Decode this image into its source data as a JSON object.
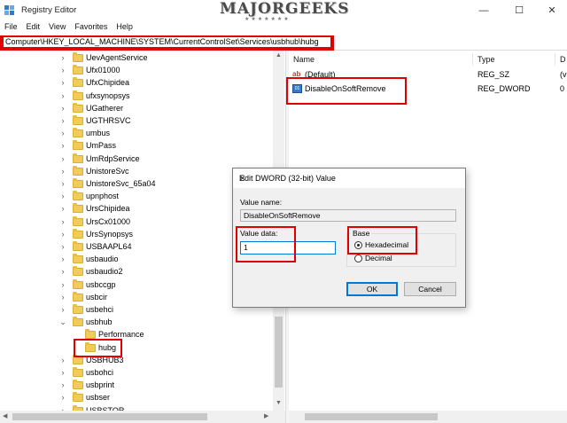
{
  "window": {
    "title": "Registry Editor",
    "watermark": "MAJORGEEKS",
    "watermark_sub": "★★★★★★★",
    "minimize": "—",
    "maximize": "☐",
    "close": "✕"
  },
  "menu": [
    "File",
    "Edit",
    "View",
    "Favorites",
    "Help"
  ],
  "address": "Computer\\HKEY_LOCAL_MACHINE\\SYSTEM\\CurrentControlSet\\Services\\usbhub\\hubg",
  "tree": [
    {
      "label": "UevAgentService",
      "chev": "›"
    },
    {
      "label": "Ufx01000",
      "chev": "›"
    },
    {
      "label": "UfxChipidea",
      "chev": "›"
    },
    {
      "label": "ufxsynopsys",
      "chev": "›"
    },
    {
      "label": "UGatherer",
      "chev": "›"
    },
    {
      "label": "UGTHRSVC",
      "chev": "›"
    },
    {
      "label": "umbus",
      "chev": "›"
    },
    {
      "label": "UmPass",
      "chev": "›"
    },
    {
      "label": "UmRdpService",
      "chev": "›"
    },
    {
      "label": "UnistoreSvc",
      "chev": "›"
    },
    {
      "label": "UnistoreSvc_65a04",
      "chev": "›"
    },
    {
      "label": "upnphost",
      "chev": "›"
    },
    {
      "label": "UrsChipidea",
      "chev": "›"
    },
    {
      "label": "UrsCx01000",
      "chev": "›"
    },
    {
      "label": "UrsSynopsys",
      "chev": "›"
    },
    {
      "label": "USBAAPL64",
      "chev": "›"
    },
    {
      "label": "usbaudio",
      "chev": "›"
    },
    {
      "label": "usbaudio2",
      "chev": "›"
    },
    {
      "label": "usbccgp",
      "chev": "›"
    },
    {
      "label": "usbcir",
      "chev": "›"
    },
    {
      "label": "usbehci",
      "chev": "›"
    },
    {
      "label": "usbhub",
      "chev": "⌄"
    },
    {
      "label": "Performance",
      "chev": ""
    },
    {
      "label": "hubg",
      "chev": ""
    },
    {
      "label": "USBHUB3",
      "chev": "›"
    },
    {
      "label": "usbohci",
      "chev": "›"
    },
    {
      "label": "usbprint",
      "chev": "›"
    },
    {
      "label": "usbser",
      "chev": "›"
    },
    {
      "label": "USBSTOR",
      "chev": "›"
    }
  ],
  "values": {
    "columns": [
      "Name",
      "Type",
      "D"
    ],
    "rows": [
      {
        "icon": "ab",
        "name": "(Default)",
        "type": "REG_SZ",
        "data": "(v"
      },
      {
        "icon": "dword",
        "name": "DisableOnSoftRemove",
        "type": "REG_DWORD",
        "data": "0"
      }
    ]
  },
  "dialog": {
    "title": "Edit DWORD (32-bit) Value",
    "close": "✕",
    "value_name_label": "Value name:",
    "value_name": "DisableOnSoftRemove",
    "value_data_label": "Value data:",
    "value_data": "1",
    "base_label": "Base",
    "hex_label": "Hexadecimal",
    "dec_label": "Decimal",
    "base_selected": "Hexadecimal",
    "ok": "OK",
    "cancel": "Cancel"
  },
  "colors": {
    "highlight": "#e00000",
    "folder": "#f2cc58",
    "accent": "#0078d7"
  }
}
